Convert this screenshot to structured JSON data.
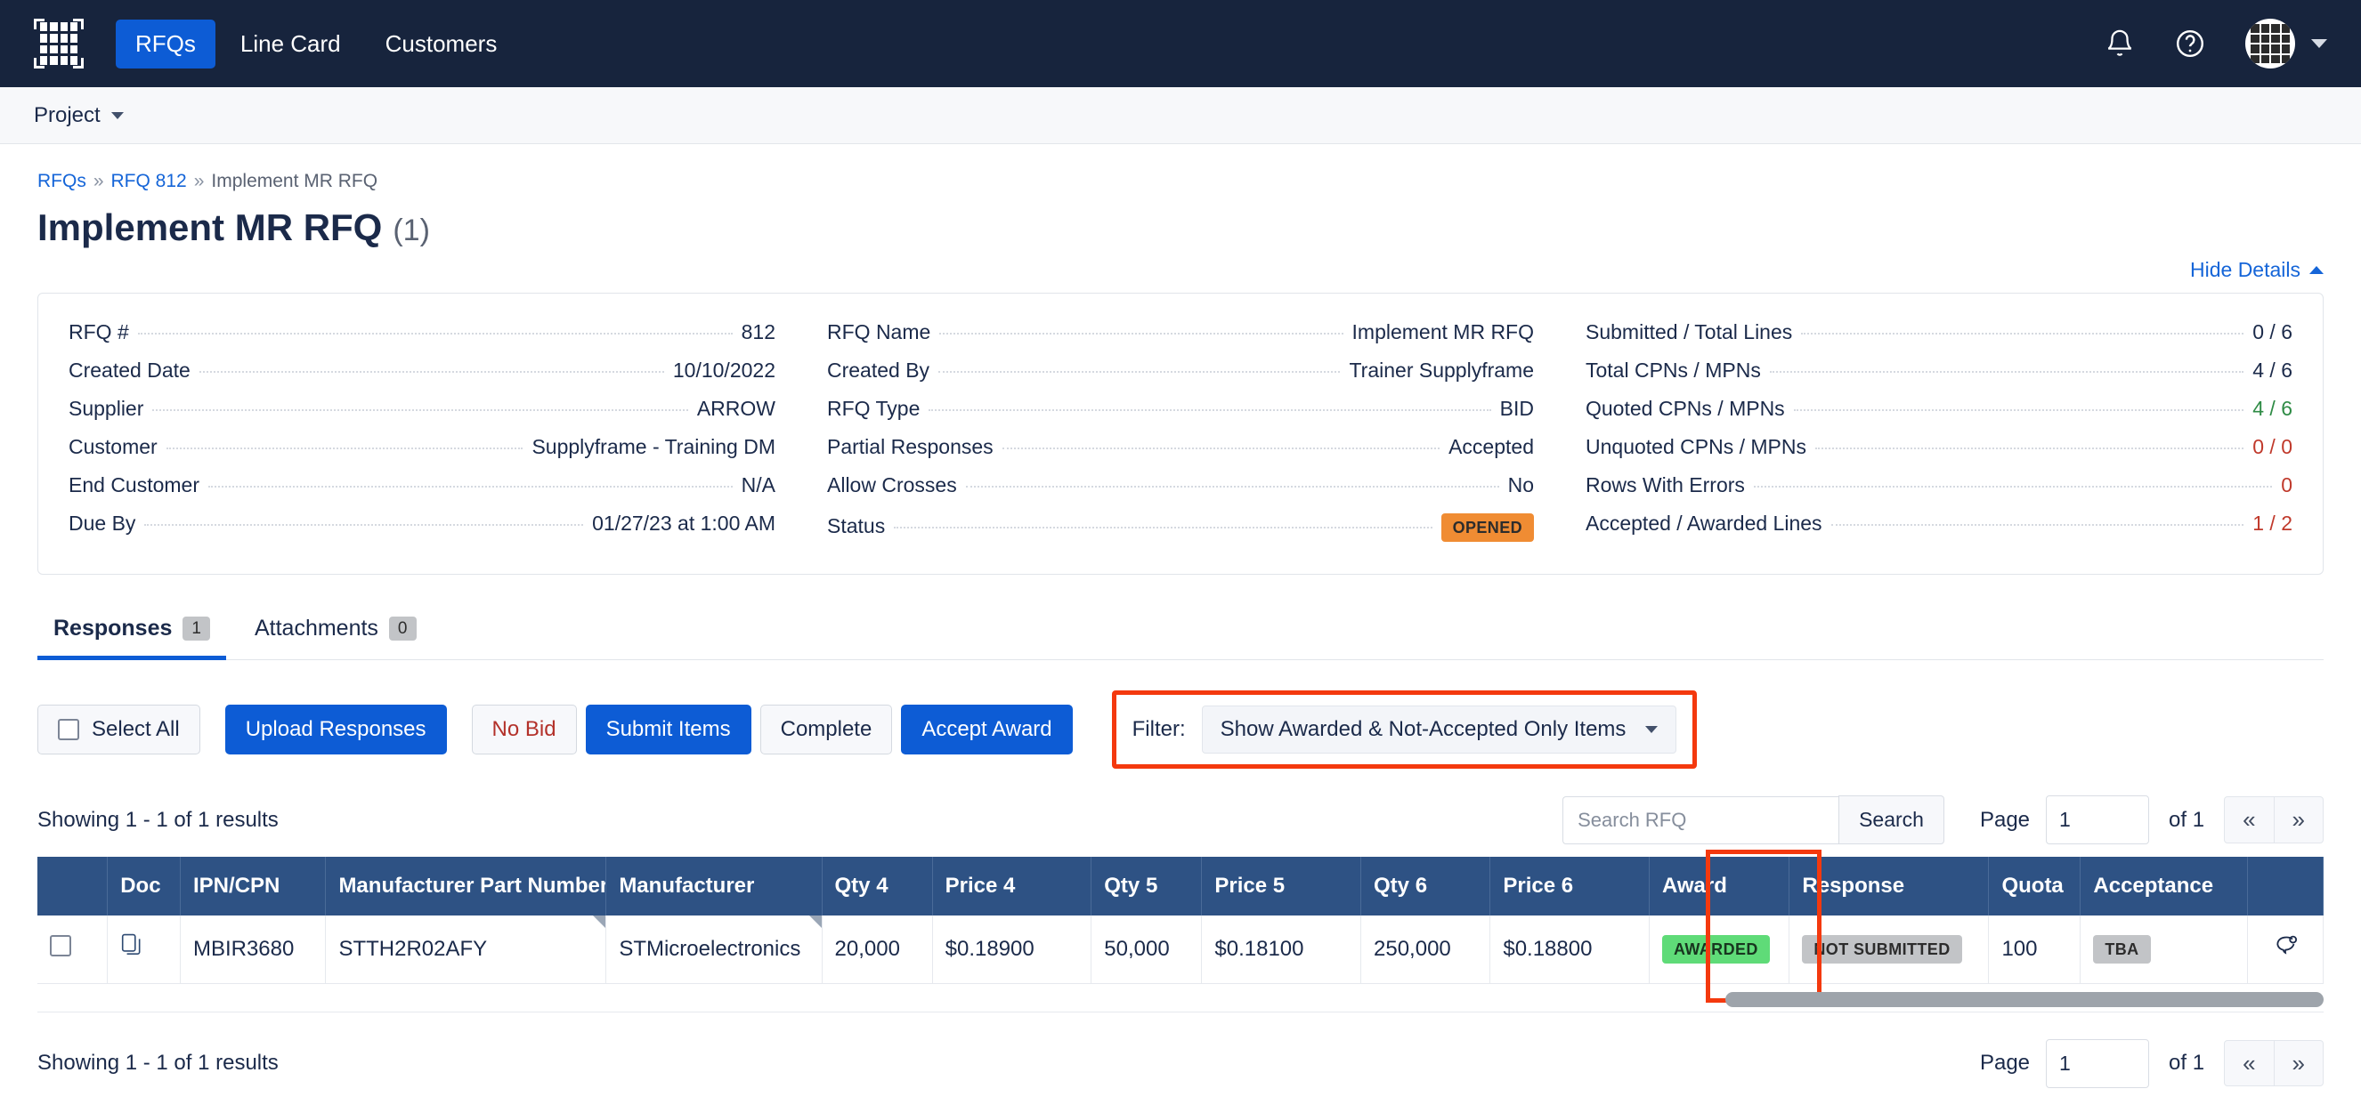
{
  "topnav": {
    "logo_name": "app-grid-logo",
    "items": [
      {
        "label": "RFQs",
        "active": true
      },
      {
        "label": "Line Card",
        "active": false
      },
      {
        "label": "Customers",
        "active": false
      }
    ],
    "bell_icon": "notification-bell-icon",
    "help_icon": "help-question-icon",
    "avatar_icon": "user-avatar"
  },
  "projectbar": {
    "label": "Project"
  },
  "breadcrumb": {
    "root": "RFQs",
    "sep1": "»",
    "parent": "RFQ 812",
    "sep2": "»",
    "current": "Implement MR RFQ"
  },
  "header": {
    "title": "Implement MR RFQ",
    "count": "(1)",
    "hide_details": "Hide Details"
  },
  "details": {
    "col1": [
      {
        "label": "RFQ #",
        "value": "812"
      },
      {
        "label": "Created Date",
        "value": "10/10/2022"
      },
      {
        "label": "Supplier",
        "value": "ARROW"
      },
      {
        "label": "Customer",
        "value": "Supplyframe - Training DM"
      },
      {
        "label": "End Customer",
        "value": "N/A"
      },
      {
        "label": "Due By",
        "value": "01/27/23 at 1:00 AM"
      }
    ],
    "col2": [
      {
        "label": "RFQ Name",
        "value": "Implement MR RFQ"
      },
      {
        "label": "Created By",
        "value": "Trainer Supplyframe"
      },
      {
        "label": "RFQ Type",
        "value": "BID"
      },
      {
        "label": "Partial Responses",
        "value": "Accepted"
      },
      {
        "label": "Allow Crosses",
        "value": "No"
      },
      {
        "label": "Status",
        "value": "OPENED",
        "pill": "orange"
      }
    ],
    "col3": [
      {
        "label": "Submitted / Total Lines",
        "value": "0 / 6"
      },
      {
        "label": "Total CPNs / MPNs",
        "value": "4 / 6"
      },
      {
        "label": "Quoted CPNs / MPNs",
        "value": "4 / 6",
        "tone": "green"
      },
      {
        "label": "Unquoted CPNs / MPNs",
        "value": "0 / 0",
        "tone": "red"
      },
      {
        "label": "Rows With Errors",
        "value": "0",
        "tone": "red"
      },
      {
        "label": "Accepted / Awarded Lines",
        "value": "1 / 2",
        "tone": "red"
      }
    ]
  },
  "tabs": [
    {
      "label": "Responses",
      "badge": "1",
      "active": true
    },
    {
      "label": "Attachments",
      "badge": "0",
      "active": false
    }
  ],
  "toolbar": {
    "select_all": "Select All",
    "upload_responses": "Upload Responses",
    "no_bid": "No Bid",
    "submit_items": "Submit Items",
    "complete": "Complete",
    "accept_award": "Accept Award",
    "filter_label": "Filter:",
    "filter_value": "Show Awarded & Not-Accepted Only Items"
  },
  "results": {
    "showing": "Showing 1 - 1 of 1 results",
    "search_placeholder": "Search RFQ",
    "search_value": "",
    "search_button": "Search",
    "page_label": "Page",
    "page_value": "1",
    "of_label": "of 1",
    "prev": "«",
    "next": "»"
  },
  "table": {
    "columns": [
      "",
      "Doc",
      "IPN/CPN",
      "Manufacturer Part Number",
      "Manufacturer",
      "Qty 4",
      "Price 4",
      "Qty 5",
      "Price 5",
      "Qty 6",
      "Price 6",
      "Award",
      "Response",
      "Quota",
      "Acceptance",
      ""
    ],
    "rows": [
      {
        "checkbox": "",
        "doc": "document-copy-icon",
        "ipn_cpn": "MBIR3680",
        "mpn": "STTH2R02AFY",
        "manufacturer": "STMicroelectronics",
        "qty4": "20,000",
        "price4": "$0.18900",
        "qty5": "50,000",
        "price5": "$0.18100",
        "qty6": "250,000",
        "price6": "$0.18800",
        "award": "AWARDED",
        "response": "NOT SUBMITTED",
        "quota": "100",
        "acceptance": "TBA",
        "action": "chat-bubble-icon"
      }
    ]
  },
  "bottom": {
    "showing": "Showing 1 - 1 of 1 results",
    "page_label": "Page",
    "page_value": "1",
    "of_label": "of 1",
    "prev": "«",
    "next": "»"
  },
  "colors": {
    "nav_bg": "#17243d",
    "accent_blue": "#0d5cd5",
    "table_header": "#2e5284",
    "status_orange": "#f08c33",
    "awarded_green": "#5fdb78",
    "highlight_red": "#f4390e"
  }
}
